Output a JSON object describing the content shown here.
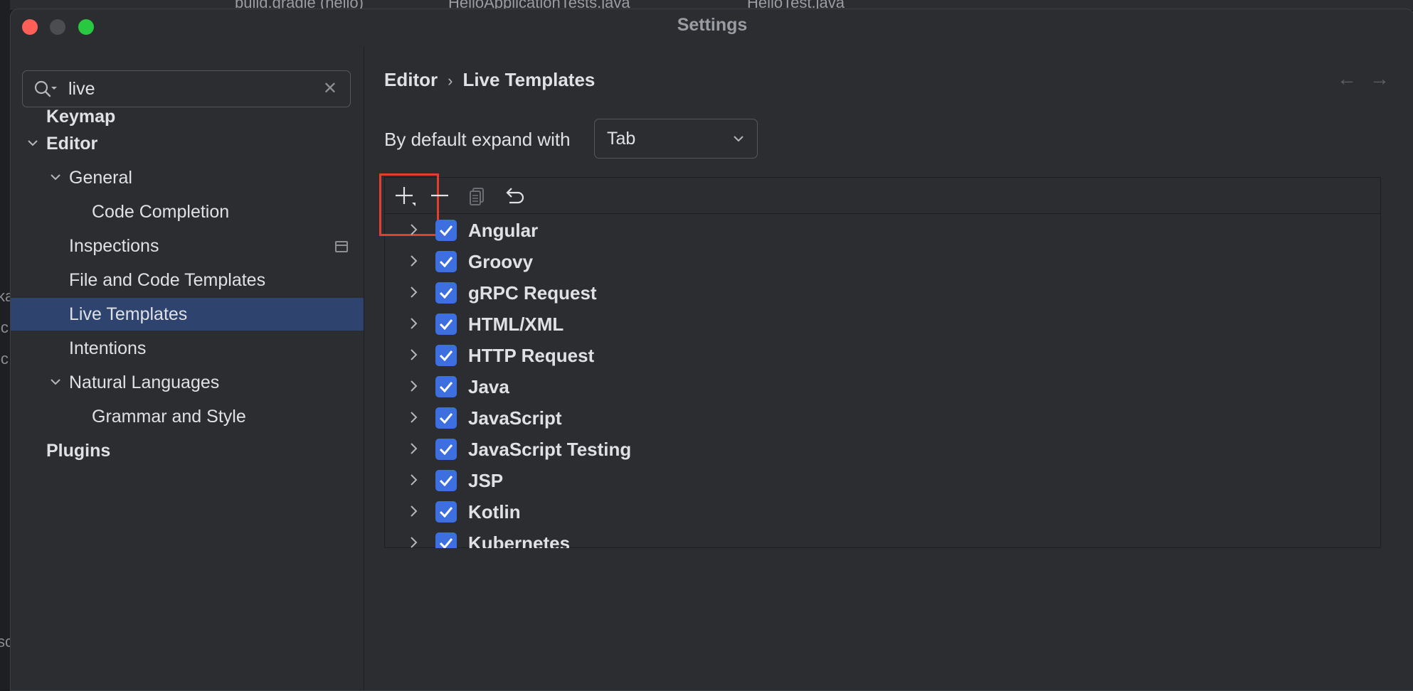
{
  "background_ide": {
    "tabs": [
      "build.gradle (hello)",
      "HelloApplicationTests.java",
      "HelloTest.java"
    ],
    "left_fragments": [
      "ka",
      "lc",
      "lc",
      "sc"
    ]
  },
  "window": {
    "title": "Settings"
  },
  "search": {
    "value": "live"
  },
  "sidebar": {
    "items": [
      {
        "label": "Keymap"
      },
      {
        "label": "Editor"
      },
      {
        "label": "General"
      },
      {
        "label": "Code Completion"
      },
      {
        "label": "Inspections"
      },
      {
        "label": "File and Code Templates"
      },
      {
        "label": "Live Templates"
      },
      {
        "label": "Intentions"
      },
      {
        "label": "Natural Languages"
      },
      {
        "label": "Grammar and Style"
      },
      {
        "label": "Plugins"
      }
    ],
    "selected": "Live Templates"
  },
  "breadcrumb": {
    "parent": "Editor",
    "current": "Live Templates"
  },
  "expand": {
    "label": "By default expand with",
    "value": "Tab"
  },
  "toolbar": {
    "buttons": [
      "add-icon",
      "remove-icon",
      "copy-icon",
      "undo-icon"
    ],
    "highlighted": "add-icon"
  },
  "template_groups": [
    {
      "name": "Angular",
      "checked": true
    },
    {
      "name": "Groovy",
      "checked": true
    },
    {
      "name": "gRPC Request",
      "checked": true
    },
    {
      "name": "HTML/XML",
      "checked": true
    },
    {
      "name": "HTTP Request",
      "checked": true
    },
    {
      "name": "Java",
      "checked": true
    },
    {
      "name": "JavaScript",
      "checked": true
    },
    {
      "name": "JavaScript Testing",
      "checked": true
    },
    {
      "name": "JSP",
      "checked": true
    },
    {
      "name": "Kotlin",
      "checked": true
    },
    {
      "name": "Kubernetes",
      "checked": true
    }
  ],
  "colors": {
    "accent": "#3d6fe0",
    "selection": "#2e436e",
    "highlight_box": "#e0402d"
  }
}
